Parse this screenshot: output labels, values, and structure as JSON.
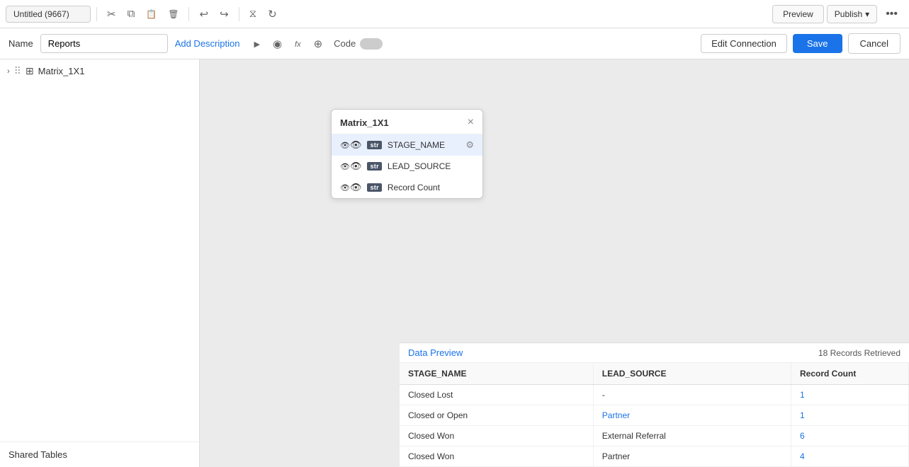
{
  "topbar": {
    "tab_title": "Untitled (9667)",
    "preview_label": "Preview",
    "publish_label": "Publish",
    "more_icon": "•••"
  },
  "namebar": {
    "name_label": "Name",
    "name_value": "Reports",
    "add_description_label": "Add Description",
    "code_label": "Code",
    "edit_connection_label": "Edit Connection",
    "save_label": "Save",
    "cancel_label": "Cancel"
  },
  "sidebar": {
    "items": [
      {
        "label": "Matrix_1X1"
      }
    ],
    "shared_tables_label": "Shared Tables"
  },
  "matrix_card": {
    "title": "Matrix_1X1",
    "fields": [
      {
        "name": "STAGE_NAME",
        "type": "str",
        "active": true
      },
      {
        "name": "LEAD_SOURCE",
        "type": "str",
        "active": false
      },
      {
        "name": "Record Count",
        "type": "str",
        "active": false
      }
    ]
  },
  "data_preview": {
    "label": "Data Preview",
    "records_retrieved": "18 Records Retrieved",
    "columns": [
      "STAGE_NAME",
      "LEAD_SOURCE",
      "Record Count"
    ],
    "rows": [
      {
        "stage_name": "Closed Lost",
        "lead_source": "-",
        "record_count": "1",
        "count_link": true
      },
      {
        "stage_name": "Closed or Open",
        "lead_source": "Partner",
        "record_count": "1",
        "count_link": true,
        "lead_link": true
      },
      {
        "stage_name": "Closed Won",
        "lead_source": "External Referral",
        "record_count": "6",
        "count_link": true,
        "lead_link": false
      },
      {
        "stage_name": "Closed Won",
        "lead_source": "Partner",
        "record_count": "4",
        "count_link": true,
        "lead_link": false
      }
    ]
  }
}
